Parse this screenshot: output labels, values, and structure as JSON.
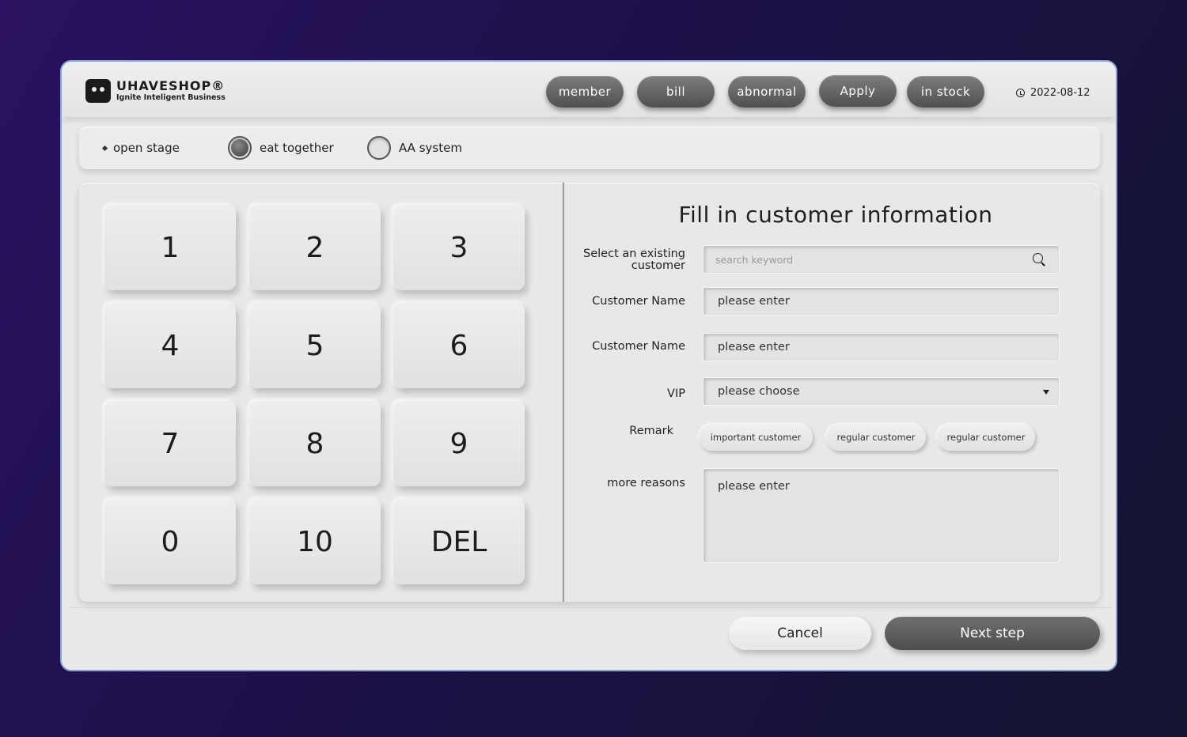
{
  "brand": {
    "name": "UHAVESHOP®",
    "tagline": "Ignite Inteligent Business"
  },
  "nav": {
    "items": [
      {
        "label": "member"
      },
      {
        "label": "bill"
      },
      {
        "label": "abnormal"
      },
      {
        "label": "Apply"
      },
      {
        "label": "in stock"
      }
    ],
    "date": "2022-08-12"
  },
  "modes": {
    "open_stage": "open stage",
    "eat_together": "eat together",
    "aa_system": "AA system",
    "selected": "eat together"
  },
  "keypad": {
    "keys": [
      "1",
      "2",
      "3",
      "4",
      "5",
      "6",
      "7",
      "8",
      "9",
      "0",
      "10",
      "DEL"
    ]
  },
  "form": {
    "title": "Fill in customer information",
    "existing_label": "Select an existing customer",
    "search_placeholder": "search keyword",
    "name_label_1": "Customer Name",
    "name_value_1": "please enter",
    "name_label_2": "Customer Name",
    "name_value_2": "please enter",
    "vip_label": "VIP",
    "vip_value": "please choose",
    "remark_label": "Remark",
    "remark_chips": [
      "important customer",
      "regular customer",
      "regular customer"
    ],
    "reasons_label": "more reasons",
    "reasons_value": "please enter"
  },
  "actions": {
    "cancel": "Cancel",
    "next": "Next step"
  }
}
